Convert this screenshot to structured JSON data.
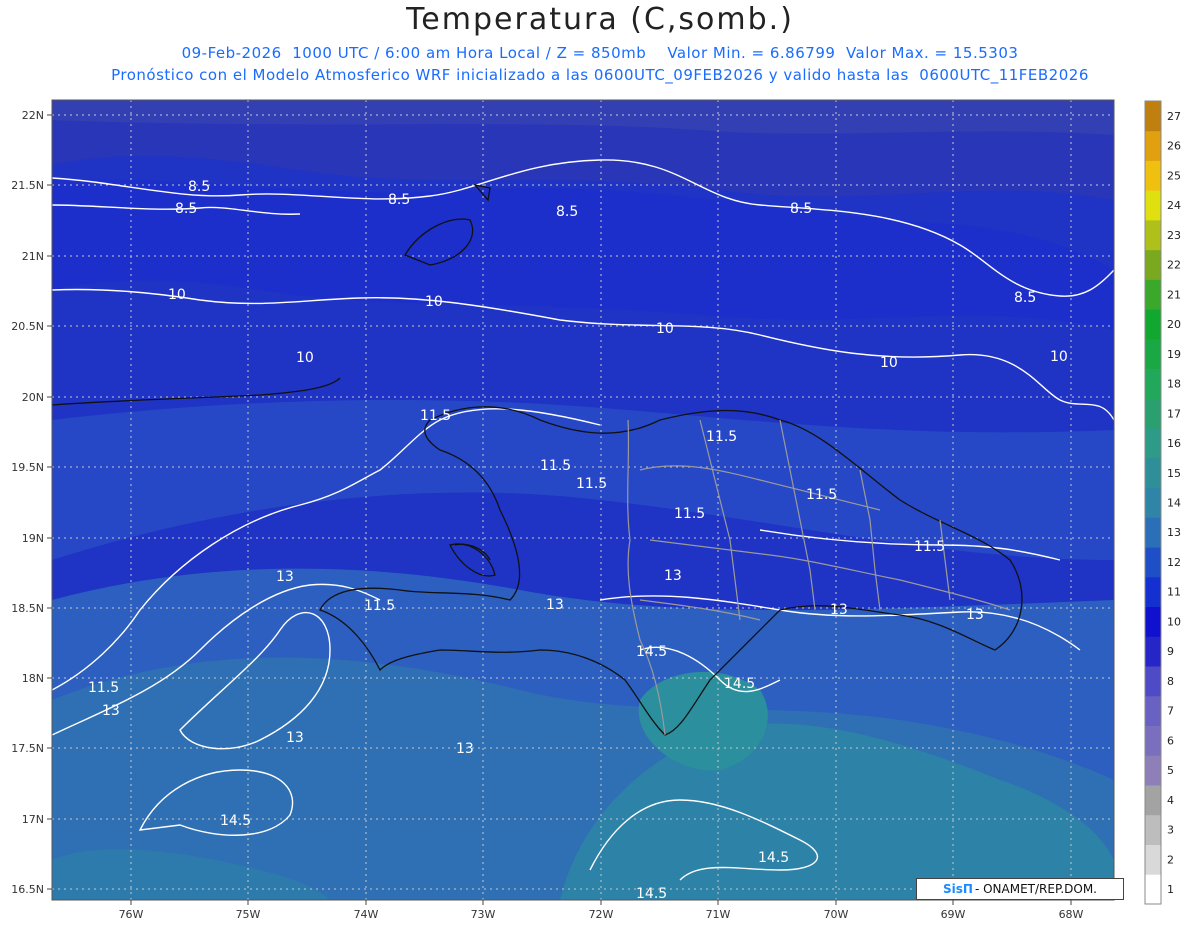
{
  "header": {
    "title": "Temperatura (C,somb.)",
    "line1": "09-Feb-2026  1000 UTC / 6:00 am Hora Local / Z = 850mb    Valor Min. = 6.86799  Valor Max. = 15.5303",
    "line2": "Pronóstico con el Modelo Atmosferico WRF inicializado a las 0600UTC_09FEB2026 y valido hasta las  0600UTC_11FEB2026"
  },
  "map": {
    "lat_labels": [
      "22N",
      "21.5N",
      "21N",
      "20.5N",
      "20N",
      "19.5N",
      "19N",
      "18.5N",
      "18N",
      "17.5N",
      "17N",
      "16.5N"
    ],
    "lon_labels": [
      "76W",
      "75W",
      "74W",
      "73W",
      "72W",
      "71W",
      "70W",
      "69W",
      "68W"
    ],
    "contour_labels": [
      "8.5",
      "8.5",
      "8.5",
      "8.5",
      "8.5",
      "8.5",
      "10",
      "10",
      "10",
      "10",
      "10",
      "10",
      "11.5",
      "11.5",
      "11.5",
      "11.5",
      "11.5",
      "11.5",
      "11.5",
      "11.5",
      "11.5",
      "13",
      "13",
      "13",
      "13",
      "13",
      "13",
      "13",
      "13",
      "14.5",
      "14.5",
      "14.5",
      "14.5"
    ],
    "colors": {
      "cold_band": "#2a36b8",
      "mid_band": "#1f35c8",
      "warm_band": "#2c5fbf",
      "warmer_band": "#2d7fa6",
      "contour": "#ffffff",
      "coast": "#111111",
      "provinces": "#9a9a9a"
    }
  },
  "colorbar": {
    "labels": [
      "1",
      "2",
      "3",
      "4",
      "5",
      "6",
      "7",
      "8",
      "9",
      "10",
      "11",
      "12",
      "13",
      "14",
      "15",
      "16",
      "17",
      "18",
      "19",
      "20",
      "21",
      "22",
      "23",
      "24",
      "25",
      "26",
      "27"
    ],
    "colors": [
      "#ffffff",
      "#d9d9d9",
      "#bdbdbd",
      "#a3a3a3",
      "#8f7fb8",
      "#7a6fbe",
      "#6a62c2",
      "#4f4ac6",
      "#2525c8",
      "#1010cf",
      "#1530d0",
      "#1e4fc6",
      "#2a6fb8",
      "#2e85a8",
      "#2e8f98",
      "#2e9a88",
      "#2aa070",
      "#22a85a",
      "#1aa845",
      "#12a830",
      "#3aa82a",
      "#7aa81f",
      "#b0c01a",
      "#e0e010",
      "#f0c010",
      "#e0a010",
      "#c08010"
    ]
  },
  "credit": {
    "logo": "SisΠ",
    "text": "- ONAMET/REP.DOM."
  }
}
